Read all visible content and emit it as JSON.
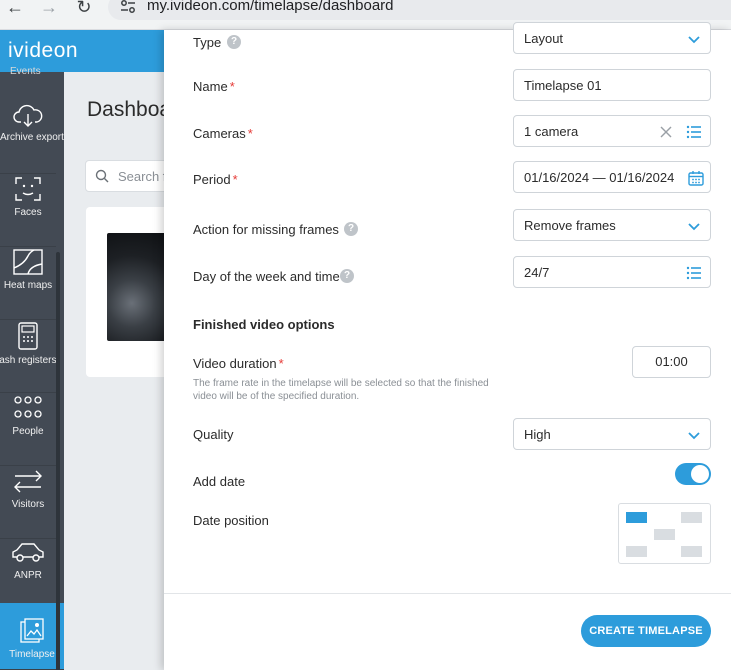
{
  "browser": {
    "url": "my.ivideon.com/timelapse/dashboard",
    "back_icon": "arrow-left-icon",
    "forward_icon": "arrow-right-icon",
    "reload_icon": "reload-icon"
  },
  "app": {
    "brand": "ivideon",
    "accent_color": "#2d9cdb",
    "sidebar_color": "#434a54"
  },
  "sidebar": {
    "cut_label": "Events",
    "items": [
      {
        "label": "Archive export",
        "icon": "cloud-download-icon"
      },
      {
        "label": "Faces",
        "icon": "face-frame-icon"
      },
      {
        "label": "Heat maps",
        "icon": "heat-map-icon"
      },
      {
        "label": "Cash registers",
        "icon": "cash-register-icon"
      },
      {
        "label": "People",
        "icon": "people-icon"
      },
      {
        "label": "Visitors",
        "icon": "arrows-icon"
      },
      {
        "label": "ANPR",
        "icon": "car-icon"
      },
      {
        "label": "Timelapse",
        "icon": "timelapse-icon",
        "active": true
      }
    ]
  },
  "dashboard": {
    "title": "Dashboa",
    "search_placeholder": "Search f"
  },
  "form": {
    "type": {
      "label": "Type",
      "value": "Layout"
    },
    "name": {
      "label": "Name",
      "value": "Timelapse 01"
    },
    "cameras": {
      "label": "Cameras",
      "value": "1 camera"
    },
    "period": {
      "label": "Period",
      "value": "01/16/2024 — 01/16/2024"
    },
    "missing_frames": {
      "label": "Action for missing frames",
      "value": "Remove frames"
    },
    "schedule": {
      "label": "Day of the week and time",
      "value": "24/7"
    },
    "section_title": "Finished video options",
    "duration": {
      "label": "Video duration",
      "value": "01:00",
      "hint": "The frame rate in the timelapse will be selected so that the finished video will be of the specified duration."
    },
    "quality": {
      "label": "Quality",
      "value": "High"
    },
    "add_date": {
      "label": "Add date",
      "enabled": true
    },
    "date_position": {
      "label": "Date position",
      "selected": "top-left"
    },
    "required_mark": "*",
    "help_mark": "?",
    "submit_label": "CREATE TIMELAPSE"
  }
}
